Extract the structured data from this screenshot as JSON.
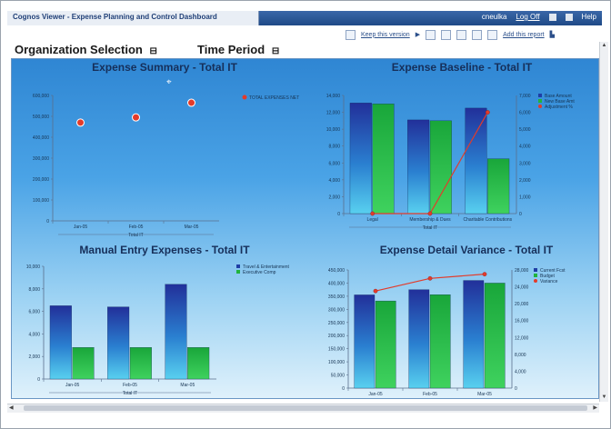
{
  "window": {
    "title": "Cognos Viewer - Expense Planning and Control Dashboard",
    "user": "cneulka",
    "logoff": "Log Off",
    "search_icon": "search-icon",
    "home_icon": "home-icon",
    "help_icon": "help-icon",
    "help_text": "Help"
  },
  "toolbar": {
    "keep_version": "Keep this version",
    "add_report": "Add this report"
  },
  "prompts": {
    "organization": "Organization Selection",
    "time_period": "Time Period"
  },
  "colors": {
    "bar_blue": "#1f3ea6",
    "bar_green": "#21b33d",
    "line_red": "#e33b2a"
  },
  "chart_data": [
    {
      "type": "scatter",
      "title": "Expense Summary - Total IT",
      "categories": [
        "Jan-05",
        "Feb-05",
        "Mar-05"
      ],
      "axis_group": "Total IT",
      "series": [
        {
          "name": "TOTAL EXPENSES NET",
          "values": [
            470000,
            495000,
            565000
          ]
        }
      ],
      "yticks": [
        "0",
        "100,000",
        "200,000",
        "300,000",
        "400,000",
        "500,000",
        "600,000"
      ],
      "ylim": [
        0,
        600000
      ]
    },
    {
      "type": "bar",
      "title": "Expense Baseline - Total IT",
      "categories": [
        "Legal",
        "Membership & Dues",
        "Charitable Contributions"
      ],
      "axis_group": "Total IT",
      "series": [
        {
          "name": "Base Amount",
          "values": [
            13100,
            11100,
            12500
          ]
        },
        {
          "name": "New Base Amt",
          "values": [
            13000,
            11000,
            6500
          ]
        },
        {
          "name": "Adjustment %",
          "values": [
            0,
            0,
            6000
          ]
        }
      ],
      "yticks": [
        "0",
        "2,000",
        "4,000",
        "6,000",
        "8,000",
        "10,000",
        "12,000",
        "14,000"
      ],
      "ylim": [
        0,
        14000
      ],
      "y2ticks": [
        "0",
        "1,000",
        "2,000",
        "3,000",
        "4,000",
        "5,000",
        "6,000",
        "7,000"
      ],
      "y2lim": [
        0,
        7000
      ]
    },
    {
      "type": "bar",
      "title": "Manual Entry Expenses - Total IT",
      "categories": [
        "Jan-05",
        "Feb-05",
        "Mar-05"
      ],
      "axis_group": "Total IT",
      "series": [
        {
          "name": "Travel & Entertainment",
          "values": [
            6500,
            6400,
            8400
          ]
        },
        {
          "name": "Executive Comp",
          "values": [
            2800,
            2800,
            2800
          ]
        }
      ],
      "yticks": [
        "0",
        "2,000",
        "4,000",
        "6,000",
        "8,000",
        "10,000"
      ],
      "ylim": [
        0,
        10000
      ]
    },
    {
      "type": "bar",
      "title": "Expense Detail Variance - Total IT",
      "categories": [
        "Jan-05",
        "Feb-05",
        "Mar-05"
      ],
      "series": [
        {
          "name": "Current Fcst",
          "values": [
            355000,
            375000,
            410000
          ]
        },
        {
          "name": "Budget",
          "values": [
            332000,
            356000,
            400000
          ]
        },
        {
          "name": "Variance",
          "values": [
            23000,
            26000,
            27000
          ]
        }
      ],
      "yticks": [
        "0",
        "50,000",
        "100,000",
        "150,000",
        "200,000",
        "250,000",
        "300,000",
        "350,000",
        "400,000",
        "450,000"
      ],
      "ylim": [
        0,
        450000
      ],
      "y2ticks": [
        "0",
        "4,000",
        "8,000",
        "12,000",
        "16,000",
        "20,000",
        "24,000",
        "28,000"
      ],
      "y2lim": [
        0,
        28000
      ]
    }
  ]
}
